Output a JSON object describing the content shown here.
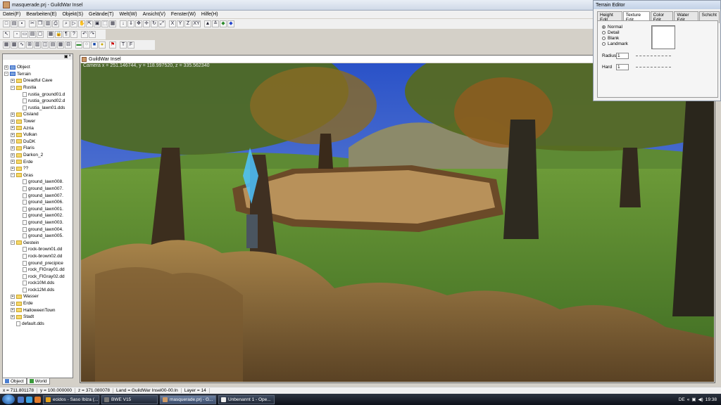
{
  "window": {
    "title": "masquerade.prj - GuildWar Insel"
  },
  "menu": [
    "Datei(F)",
    "Bearbeiten(E)",
    "Objekt(S)",
    "Gelände(T)",
    "Welt(W)",
    "Ansicht(V)",
    "Fenster(W)",
    "Hilfe(H)"
  ],
  "toolbar": {
    "axis_labels": [
      "X",
      "Y",
      "Z",
      "XY"
    ],
    "text_tools": [
      "T",
      "F"
    ]
  },
  "tree": {
    "items": [
      {
        "label": "Object",
        "level": 0,
        "kind": "root"
      },
      {
        "label": "Terrain",
        "level": 0,
        "kind": "root"
      },
      {
        "label": "Dreadful Cave",
        "level": 1,
        "kind": "folder"
      },
      {
        "label": "Rustia",
        "level": 1,
        "kind": "folder"
      },
      {
        "label": "rustia_ground01.d",
        "level": 2,
        "kind": "file"
      },
      {
        "label": "rustia_ground02.d",
        "level": 2,
        "kind": "file"
      },
      {
        "label": "rustia_lawn01.dds",
        "level": 2,
        "kind": "file"
      },
      {
        "label": "Cisland",
        "level": 1,
        "kind": "folder"
      },
      {
        "label": "Tower",
        "level": 1,
        "kind": "folder"
      },
      {
        "label": "Azria",
        "level": 1,
        "kind": "folder"
      },
      {
        "label": "Vulkan",
        "level": 1,
        "kind": "folder"
      },
      {
        "label": "DuDK",
        "level": 1,
        "kind": "folder"
      },
      {
        "label": "Flaris",
        "level": 1,
        "kind": "folder"
      },
      {
        "label": "Darkon_2",
        "level": 1,
        "kind": "folder"
      },
      {
        "label": "Erde",
        "level": 1,
        "kind": "folder"
      },
      {
        "label": "??",
        "level": 1,
        "kind": "folder"
      },
      {
        "label": "Gras",
        "level": 1,
        "kind": "folder"
      },
      {
        "label": "ground_lawn008.",
        "level": 2,
        "kind": "file"
      },
      {
        "label": "ground_lawn007.",
        "level": 2,
        "kind": "file"
      },
      {
        "label": "ground_lawn007.",
        "level": 2,
        "kind": "file"
      },
      {
        "label": "ground_lawn006.",
        "level": 2,
        "kind": "file"
      },
      {
        "label": "ground_lawn001.",
        "level": 2,
        "kind": "file"
      },
      {
        "label": "ground_lawn002.",
        "level": 2,
        "kind": "file"
      },
      {
        "label": "ground_lawn003.",
        "level": 2,
        "kind": "file"
      },
      {
        "label": "ground_lawn004.",
        "level": 2,
        "kind": "file"
      },
      {
        "label": "ground_lawn005.",
        "level": 2,
        "kind": "file"
      },
      {
        "label": "Gestein",
        "level": 1,
        "kind": "folder"
      },
      {
        "label": "rock-brown01.dd",
        "level": 2,
        "kind": "file"
      },
      {
        "label": "rock-brown02.dd",
        "level": 2,
        "kind": "file"
      },
      {
        "label": "ground_precipice",
        "level": 2,
        "kind": "file"
      },
      {
        "label": "rock_FlGray01.dd",
        "level": 2,
        "kind": "file"
      },
      {
        "label": "rock_FlGray02.dd",
        "level": 2,
        "kind": "file"
      },
      {
        "label": "rock10M.dds",
        "level": 2,
        "kind": "file"
      },
      {
        "label": "rock12M.dds",
        "level": 2,
        "kind": "file"
      },
      {
        "label": "Wasser",
        "level": 1,
        "kind": "folder"
      },
      {
        "label": "Erde",
        "level": 1,
        "kind": "folder"
      },
      {
        "label": "HalloweenTown",
        "level": 1,
        "kind": "folder"
      },
      {
        "label": "Stadt",
        "level": 1,
        "kind": "folder"
      },
      {
        "label": "default.dds",
        "level": 1,
        "kind": "file"
      }
    ],
    "tabs": [
      "Object",
      "World"
    ]
  },
  "viewport": {
    "title": "GuildWar Insel",
    "camera": "Camera x = 251.146744, y = 118.997520, z = 335.562340"
  },
  "status": [
    "x = 711.801178",
    "y = 100.000000",
    "z = 371.080078",
    "Land = GuildWar Insel00-00.ln",
    "Layer = 14"
  ],
  "terrain_editor": {
    "title": "Terrain Editor",
    "tabs": [
      "Height Edit",
      "Texture Edit",
      "Color Edit",
      "Water Edit",
      "Schicht"
    ],
    "active_tab": "Texture Edit",
    "modes": [
      "Normal",
      "Detail",
      "Blank",
      "Landmark"
    ],
    "selected_mode": "Normal",
    "radius_label": "Radius",
    "radius_value": "1",
    "hard_label": "Hard",
    "hard_value": "1"
  },
  "taskbar": {
    "tasks": [
      "ecidos - Saso Ibiza (...",
      "BWE V15",
      "masquerade.prj - G...",
      "Unbenannt 1 - Ope..."
    ],
    "active_task": "masquerade.prj - G...",
    "lang": "DE",
    "time": "19:38"
  },
  "colors": {
    "sky": "#3d63c9",
    "grass": "#4d7a2a",
    "arena_floor": "#b08a55",
    "rock": "#8a6a3c"
  }
}
